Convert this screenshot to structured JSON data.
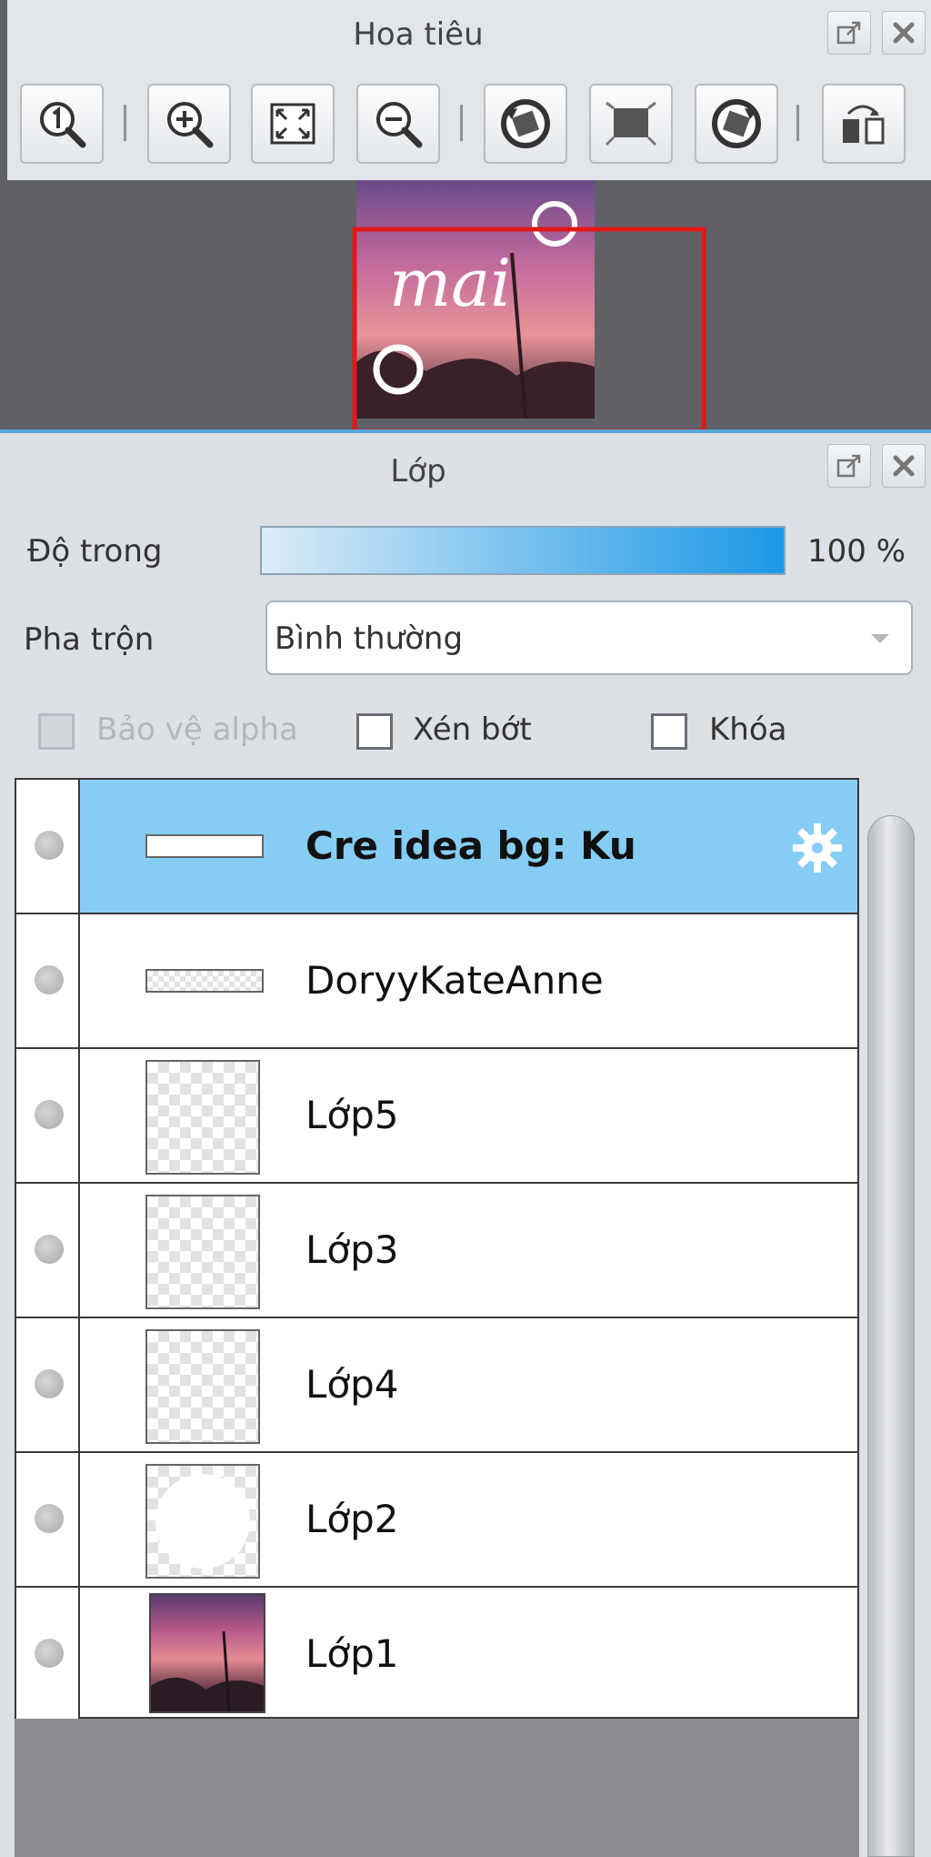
{
  "navigator": {
    "title": "Hoa tiêu",
    "toolbar": [
      {
        "name": "zoom-actual-button",
        "icon": "zoom-1-icon"
      },
      {
        "name": "zoom-in-button",
        "icon": "zoom-in-icon"
      },
      {
        "name": "fit-to-window-button",
        "icon": "fit-window-icon"
      },
      {
        "name": "zoom-out-button",
        "icon": "zoom-out-icon"
      },
      {
        "name": "rotate-left-button",
        "icon": "rotate-left-icon"
      },
      {
        "name": "reset-rotation-button",
        "icon": "reset-rotation-icon"
      },
      {
        "name": "rotate-right-button",
        "icon": "rotate-right-icon"
      },
      {
        "name": "flip-horizontal-button",
        "icon": "flip-horizontal-icon"
      }
    ],
    "preview_text": "mai"
  },
  "layers_panel": {
    "title": "Lớp",
    "opacity_label": "Độ trong",
    "opacity_value": "100 %",
    "opacity_fraction": 1.0,
    "blend_label": "Pha trộn",
    "blend_value": "Bình thường",
    "protect_alpha_label": "Bảo vệ alpha",
    "clipping_label": "Xén bớt",
    "lock_label": "Khóa",
    "layers": [
      {
        "name": "Cre idea bg: Ku",
        "selected": true,
        "thumb": "wide"
      },
      {
        "name": "DoryyKateAnne",
        "selected": false,
        "thumb": "wide"
      },
      {
        "name": "Lớp5",
        "selected": false,
        "thumb": "square"
      },
      {
        "name": "Lớp3",
        "selected": false,
        "thumb": "square"
      },
      {
        "name": "Lớp4",
        "selected": false,
        "thumb": "square"
      },
      {
        "name": "Lớp2",
        "selected": false,
        "thumb": "square"
      },
      {
        "name": "Lớp1",
        "selected": false,
        "thumb": "photo"
      }
    ]
  },
  "colors": {
    "accent": "#58a8dd",
    "selected_row": "#86cdf4",
    "view_frame": "#e01818"
  }
}
